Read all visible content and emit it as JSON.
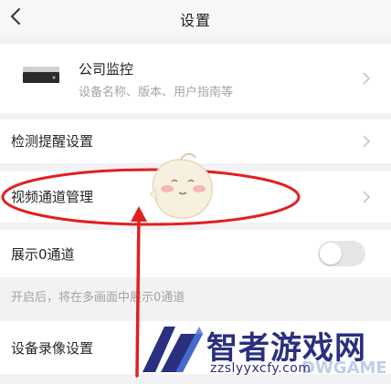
{
  "header": {
    "title": "设置",
    "back_icon": "chevron-left-icon"
  },
  "device": {
    "name": "公司监控",
    "subtitle": "设备名称、版本、用户指南等",
    "icon": "dvr-device-icon"
  },
  "rows": {
    "detect_label": "检测提醒设置",
    "video_channel_label": "视频通道管理",
    "show_channel0_label": "展示0通道",
    "show_channel0_enabled": false,
    "show_channel0_hint": "开启后，将在多画面中展示0通道",
    "record_label": "设备录像设置"
  },
  "watermark": {
    "text_cn": "智者游戏网",
    "url": "zzslyyxcfy.com",
    "bg_text": "DWGAME"
  },
  "colors": {
    "annotation_red": "#e02020",
    "watermark_navy": "#2a2f80",
    "toggle_off": "#e6e6e6"
  }
}
